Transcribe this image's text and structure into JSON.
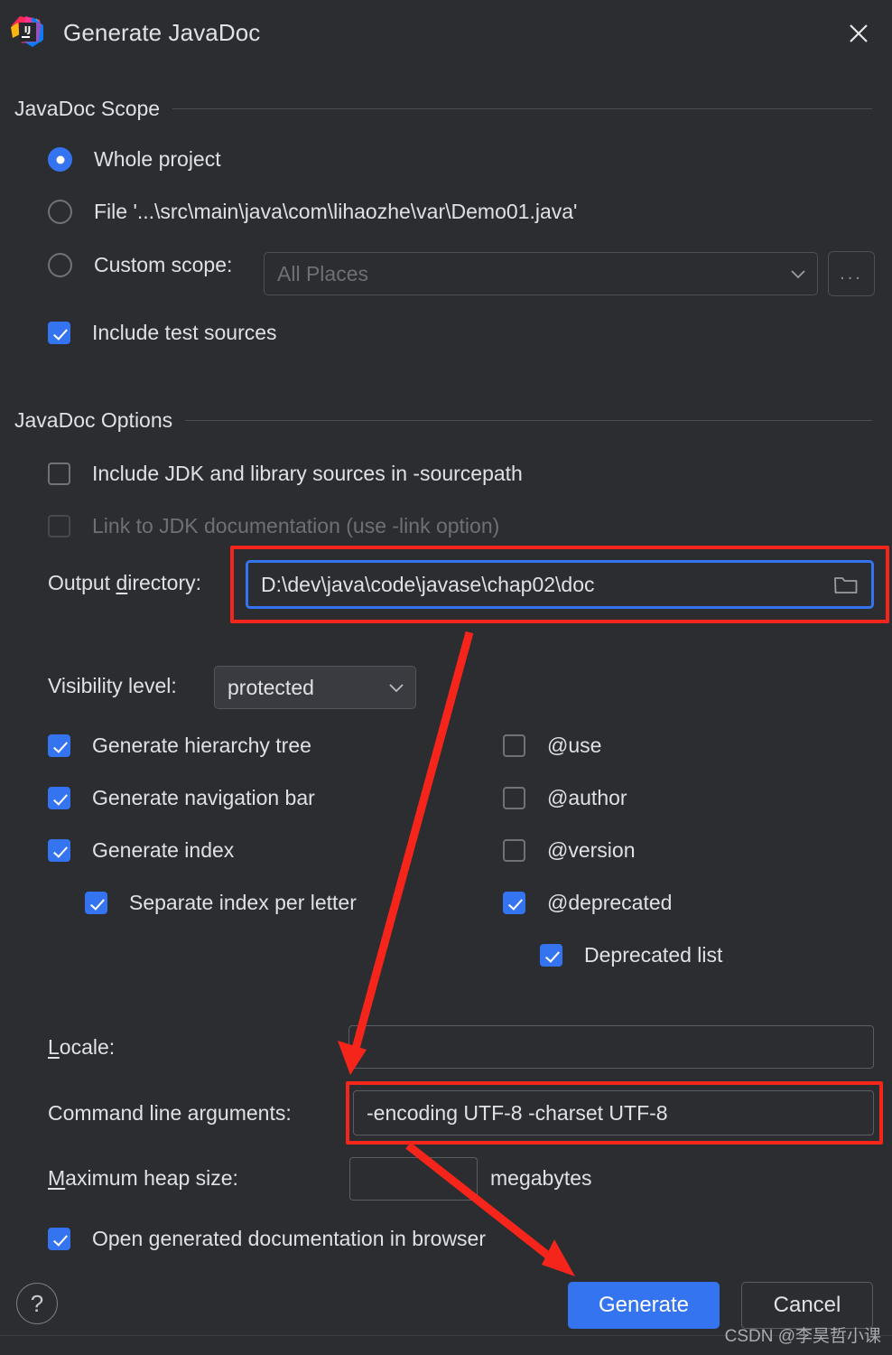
{
  "window": {
    "title": "Generate JavaDoc",
    "app_icon": "intellij-idea-logo",
    "close_icon": "close-icon"
  },
  "scope_section": {
    "heading": "JavaDoc Scope",
    "radios": [
      {
        "label": "Whole project",
        "selected": true
      },
      {
        "label": "File '...\\src\\main\\java\\com\\lihaozhe\\var\\Demo01.java'",
        "selected": false
      },
      {
        "label": "Custom scope:",
        "selected": false
      }
    ],
    "custom_scope": {
      "placeholder": "All Places",
      "value": "",
      "browse_label": "...",
      "dropdown_icon": "chevron-down-icon"
    },
    "include_test_sources": {
      "label": "Include test sources",
      "checked": true
    }
  },
  "options_section": {
    "heading": "JavaDoc Options",
    "include_jdk": {
      "label": "Include JDK and library sources in -sourcepath",
      "checked": false,
      "disabled": false
    },
    "link_jdk": {
      "label": "Link to JDK documentation (use -link option)",
      "checked": false,
      "disabled": true
    },
    "output_directory": {
      "label_pre": "Output ",
      "label_mnemonic": "d",
      "label_post": "irectory:",
      "value": "D:\\dev\\java\\code\\javase\\chap02\\doc",
      "browse_icon": "folder-icon",
      "focused": true
    },
    "visibility": {
      "label": "Visibility level:",
      "value": "protected",
      "dropdown_icon": "chevron-down-icon"
    },
    "left_checks": [
      {
        "label": "Generate hierarchy tree",
        "checked": true,
        "indent": 0
      },
      {
        "label": "Generate navigation bar",
        "checked": true,
        "indent": 0
      },
      {
        "label": "Generate index",
        "checked": true,
        "indent": 0
      },
      {
        "label": "Separate index per letter",
        "checked": true,
        "indent": 1
      }
    ],
    "right_checks": [
      {
        "label": "@use",
        "checked": false,
        "indent": 0
      },
      {
        "label": "@author",
        "checked": false,
        "indent": 0
      },
      {
        "label": "@version",
        "checked": false,
        "indent": 0
      },
      {
        "label": "@deprecated",
        "checked": true,
        "indent": 0
      },
      {
        "label": "Deprecated list",
        "checked": true,
        "indent": 1
      }
    ],
    "locale": {
      "label_mnemonic": "L",
      "label_post": "ocale:",
      "value": ""
    },
    "command_line_arguments": {
      "label": "Command line arguments:",
      "value": "-encoding UTF-8 -charset UTF-8"
    },
    "max_heap": {
      "label_mnemonic": "M",
      "label_post": "aximum heap size:",
      "value": "",
      "units": "megabytes"
    },
    "open_in_browser": {
      "label": "Open generated documentation in browser",
      "checked": true
    }
  },
  "footer": {
    "help_label": "?",
    "generate_label": "Generate",
    "cancel_label": "Cancel"
  },
  "watermark": "CSDN @李昊哲小课",
  "annotations": {
    "color": "#f5251b",
    "boxes": [
      "output-directory-field",
      "command-line-arguments-field"
    ],
    "arrows": [
      "output-directory-to-command-line-arguments",
      "command-line-arguments-to-generate-button"
    ]
  },
  "colors": {
    "background": "#2b2d30",
    "accent": "#3574f0",
    "annotation": "#f5251b",
    "text": "#dfe1e5",
    "muted": "#6e7174"
  }
}
